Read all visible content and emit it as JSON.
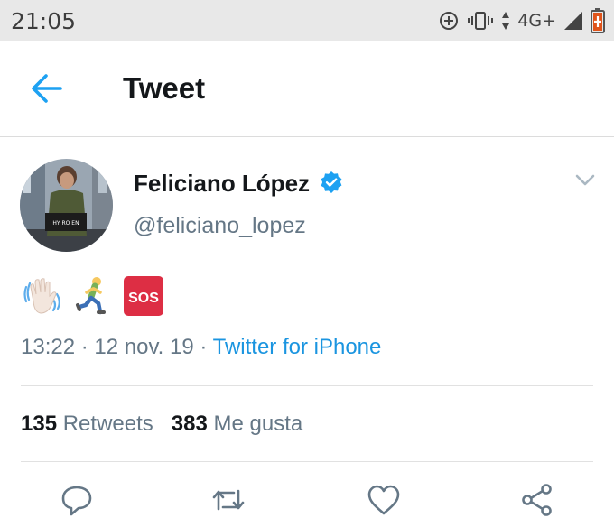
{
  "status_bar": {
    "time": "21:05",
    "network": "4G+",
    "icons": [
      "sync-icon",
      "vibrate-icon",
      "data-arrows-icon",
      "signal-icon",
      "battery-icon"
    ]
  },
  "app_bar": {
    "title": "Tweet",
    "back_icon": "arrow-left-icon",
    "accent_color": "#1da1f2"
  },
  "tweet": {
    "author_name": "Feliciano López",
    "handle": "@feliciano_lopez",
    "verified": true,
    "emojis": [
      "waving-hand-icon",
      "running-person-icon",
      "sos-icon"
    ],
    "sos_label": "SOS",
    "time": "13:22",
    "date": "12 nov. 19",
    "separator": "·",
    "source": "Twitter for iPhone",
    "avatar_text": "HY RO EN"
  },
  "stats": {
    "retweets_count": "135",
    "retweets_label": "Retweets",
    "likes_count": "383",
    "likes_label": "Me gusta"
  },
  "actions": [
    "reply-icon",
    "retweet-icon",
    "like-icon",
    "share-icon"
  ]
}
